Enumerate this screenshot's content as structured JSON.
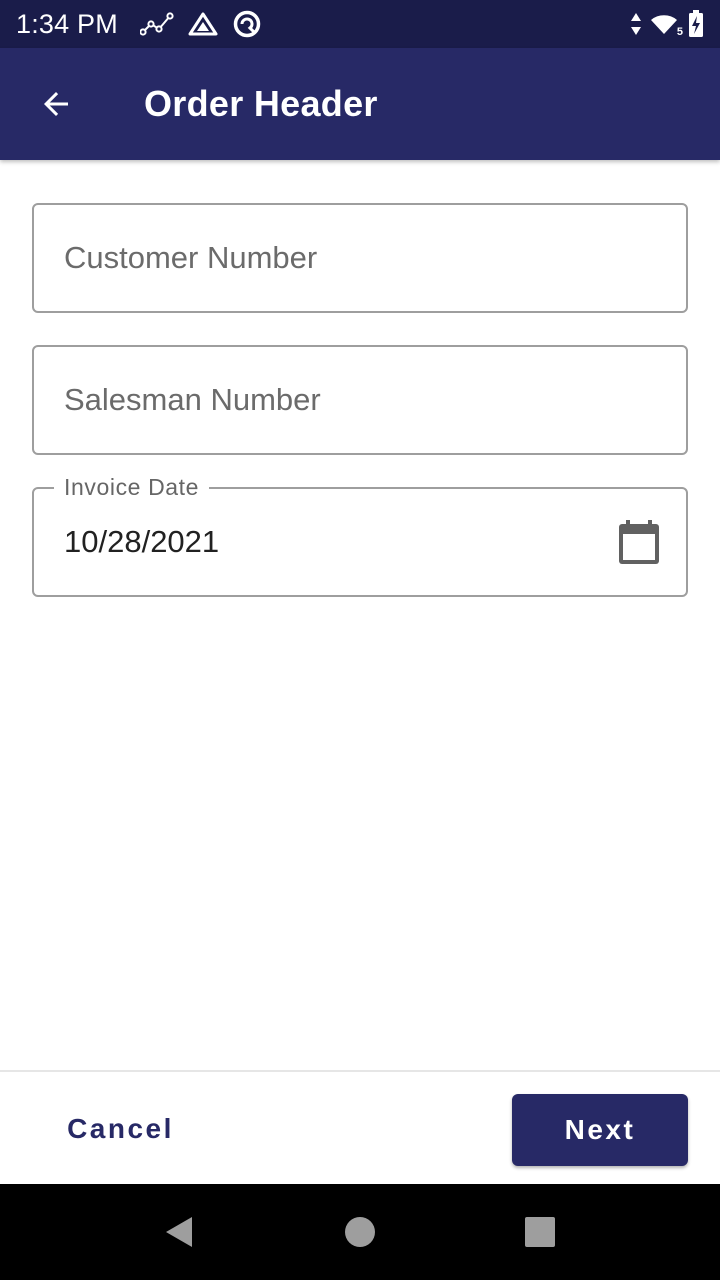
{
  "status_bar": {
    "time": "1:34 PM",
    "icons_left": [
      "analytics-icon",
      "drive-icon",
      "app-circle-icon"
    ],
    "icons_right": [
      "data-arrows-icon",
      "wifi-icon",
      "battery-charging-icon"
    ],
    "wifi_badge": "5"
  },
  "app_bar": {
    "title": "Order Header",
    "back_icon": "arrow-back-icon"
  },
  "form": {
    "customer_number": {
      "placeholder": "Customer Number",
      "value": ""
    },
    "salesman_number": {
      "placeholder": "Salesman Number",
      "value": ""
    },
    "invoice_date": {
      "label": "Invoice Date",
      "value": "10/28/2021",
      "icon": "calendar-icon"
    }
  },
  "actions": {
    "cancel_label": "Cancel",
    "next_label": "Next"
  },
  "nav_bar": {
    "icons": [
      "nav-back-icon",
      "nav-home-icon",
      "nav-recents-icon"
    ]
  },
  "colors": {
    "status_bar": "#1a1c4a",
    "primary": "#272966",
    "outline": "#9e9e9e",
    "placeholder": "#6b6b6b",
    "nav_bar": "#000000"
  }
}
